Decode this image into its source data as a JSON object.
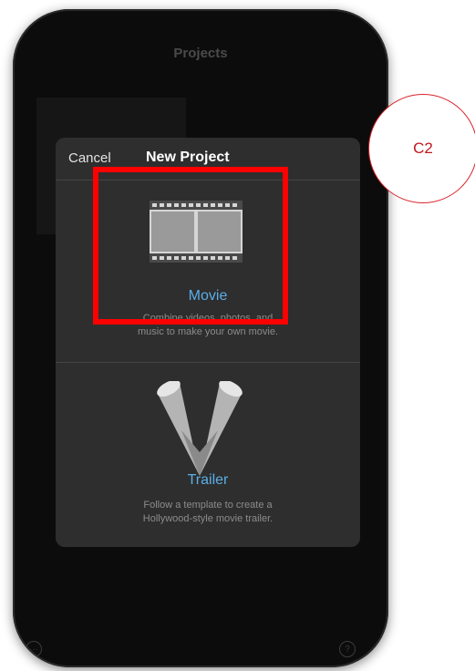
{
  "screen": {
    "title": "Projects"
  },
  "dialog": {
    "cancel_label": "Cancel",
    "title": "New Project",
    "options": [
      {
        "label": "Movie",
        "description": "Combine videos, photos, and\nmusic to make your own movie.",
        "icon": "film-strip-icon"
      },
      {
        "label": "Trailer",
        "description": "Follow a template to create a\nHollywood-style movie trailer.",
        "icon": "spotlights-icon"
      }
    ]
  },
  "toolbar": {
    "more_icon_glyph": "···",
    "help_icon_glyph": "?"
  },
  "annotation": {
    "label": "C2",
    "color": "#d8232a"
  },
  "highlight": {
    "color": "#ff0000"
  },
  "colors": {
    "accent": "#5aaee8",
    "dialog_bg": "#2e2e2e"
  }
}
